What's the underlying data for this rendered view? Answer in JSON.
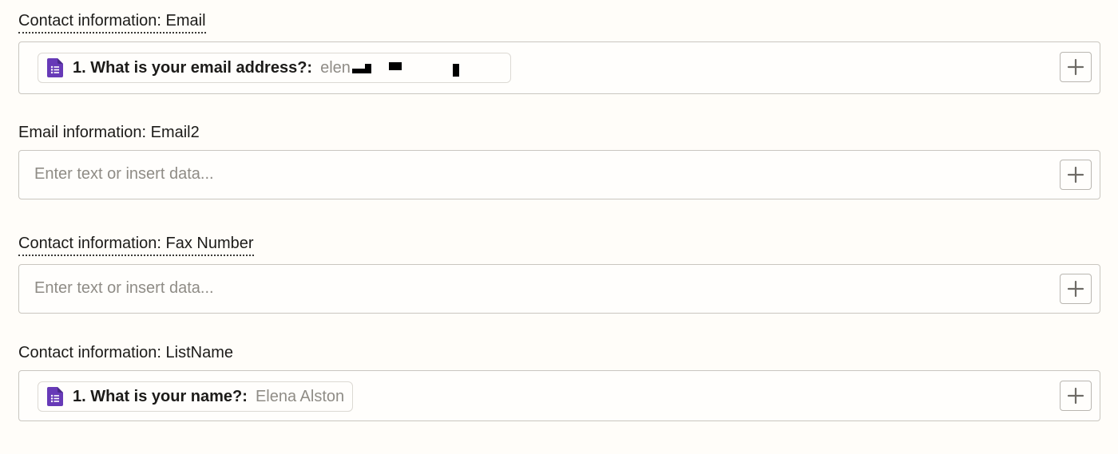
{
  "fields": [
    {
      "label": "Contact information: Email",
      "chip": {
        "key": "1. What is your email address?:",
        "value": "elen"
      }
    },
    {
      "label": "Email information: Email2",
      "placeholder": "Enter text or insert data..."
    },
    {
      "label": "Contact information: Fax Number",
      "placeholder": "Enter text or insert data..."
    },
    {
      "label": "Contact information: ListName",
      "chip": {
        "key": "1. What is your name?:",
        "value": "Elena Alston"
      }
    }
  ],
  "icons": {
    "form": "google-forms-icon",
    "insert": "plus-icon"
  },
  "colors": {
    "background": "#fffdf9",
    "forms_purple": "#673ab7",
    "border": "#c9c6c0",
    "placeholder": "#8f8c86"
  }
}
